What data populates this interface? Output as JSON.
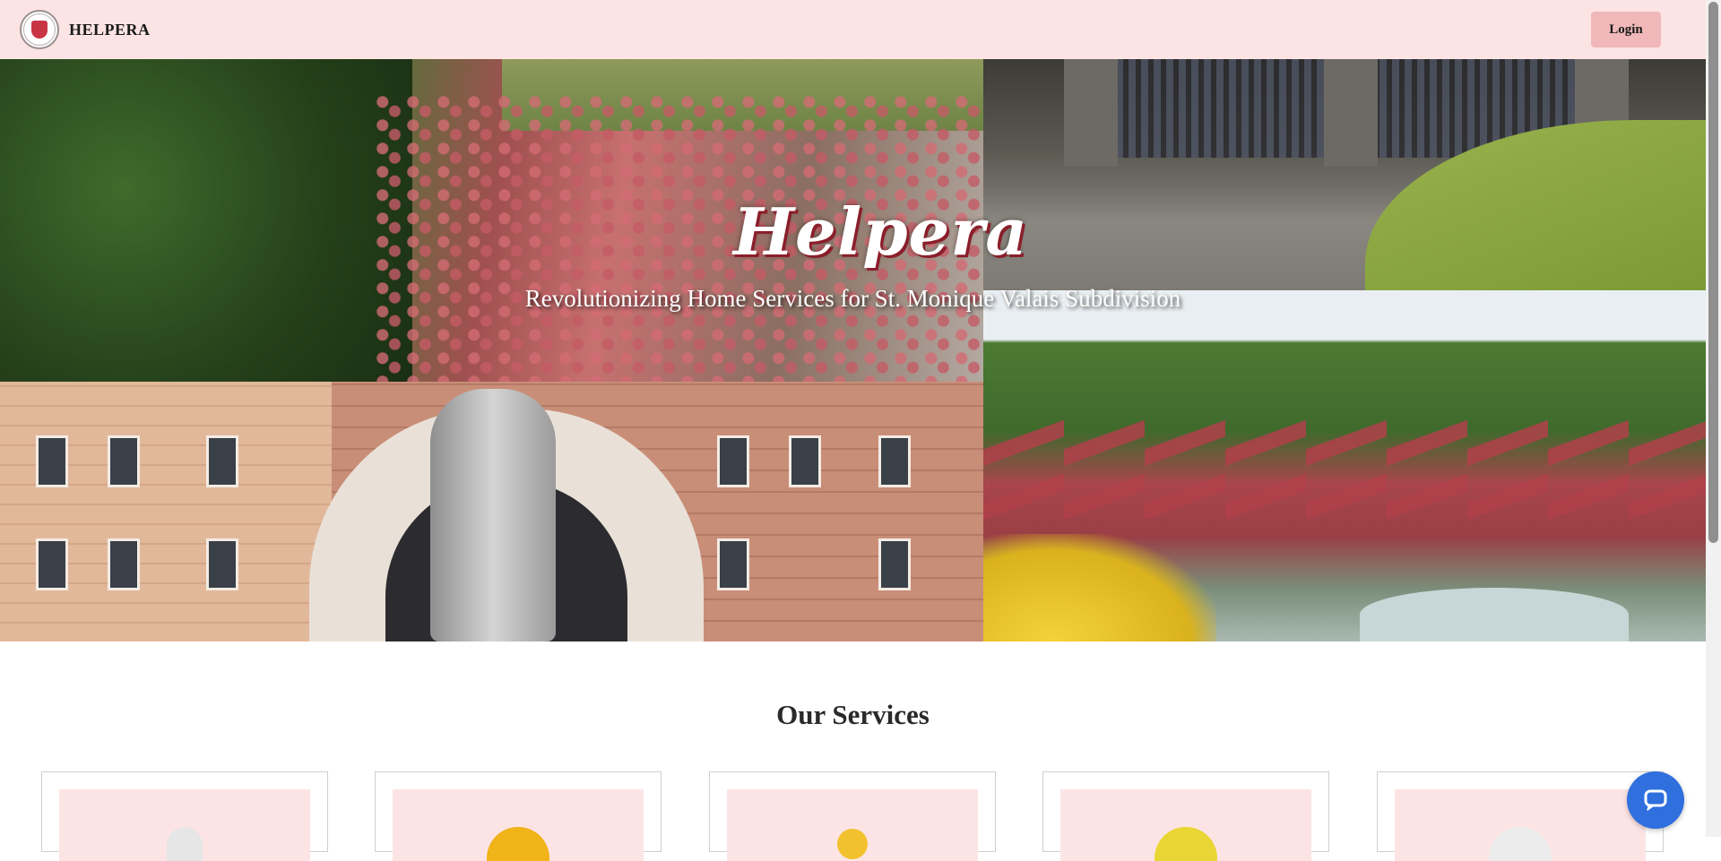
{
  "header": {
    "brand_name": "HELPERA",
    "login_label": "Login",
    "logo_icon": "subdivision-seal-logo",
    "background_color": "#fde4e4",
    "login_color": "#f0b8b8"
  },
  "hero": {
    "title": "Helpera",
    "subtitle": "Revolutionizing Home Services for St. Monique Valais Subdivision"
  },
  "services": {
    "heading": "Our Services",
    "cards": [
      {
        "icon": "gloves-icon"
      },
      {
        "icon": "hard-hat-icon"
      },
      {
        "icon": "wrench-icon"
      },
      {
        "icon": "ball-icon"
      },
      {
        "icon": "bucket-icon"
      }
    ]
  },
  "chat": {
    "icon": "chat-bubble-icon",
    "color": "#2f6fde"
  }
}
